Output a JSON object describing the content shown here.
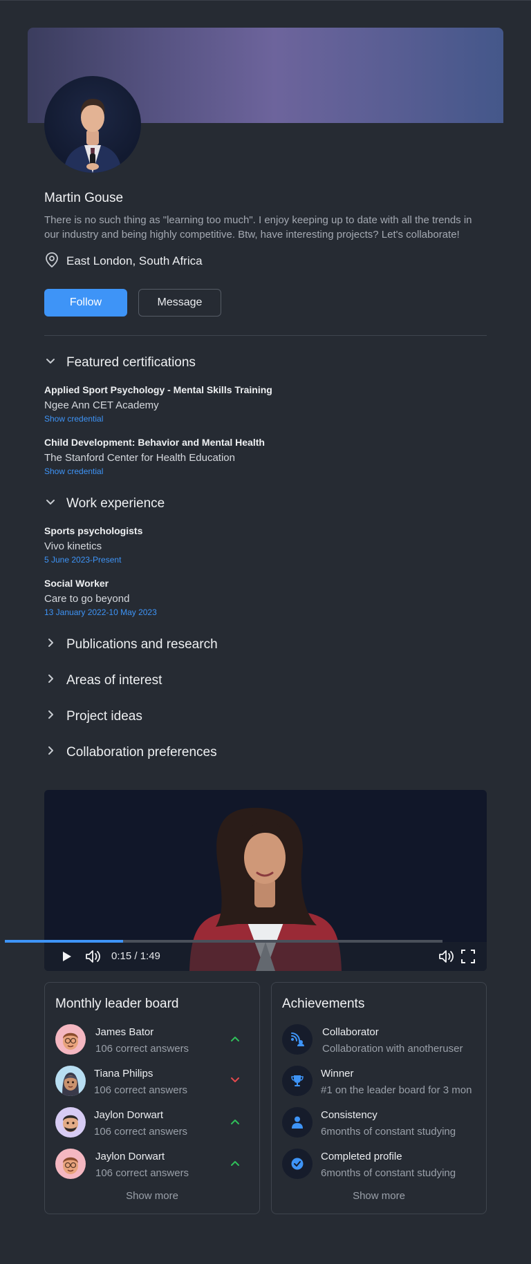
{
  "profile": {
    "name": "Martin Gouse",
    "bio": "There is no such thing as \"learning too much\". I enjoy keeping up to date with all the trends in our industry and being highly competitive. Btw, have interesting projects? Let's collaborate!",
    "location": "East London, South Africa",
    "follow_label": "Follow",
    "message_label": "Message"
  },
  "sections": {
    "certifications": {
      "title": "Featured certifications",
      "items": [
        {
          "title": "Applied Sport Psychology - Mental Skills Training",
          "org": "Ngee Ann CET Academy",
          "link": "Show credential"
        },
        {
          "title": "Child Development: Behavior and Mental Health",
          "org": "The Stanford Center for Health Education",
          "link": "Show credential"
        }
      ]
    },
    "work": {
      "title": "Work experience",
      "items": [
        {
          "title": "Sports psychologists",
          "org": "Vivo kinetics",
          "dates": "5 June 2023-Present"
        },
        {
          "title": "Social Worker",
          "org": "Care to go beyond",
          "dates": "13 January 2022-10 May 2023"
        }
      ]
    },
    "collapsed": [
      "Publications and research",
      "Areas of interest",
      "Project ideas",
      "Collaboration preferences"
    ]
  },
  "video": {
    "time": "0:15 / 1:49",
    "progress_fraction": 0.27
  },
  "leaderboard": {
    "title": "Monthly leader board",
    "rows": [
      {
        "name": "James Bator",
        "score": "106 correct answers",
        "trend": "up"
      },
      {
        "name": "Tiana Philips",
        "score": "106 correct answers",
        "trend": "down"
      },
      {
        "name": "Jaylon Dorwart",
        "score": "106 correct answers",
        "trend": "up"
      },
      {
        "name": "Jaylon Dorwart",
        "score": "106 correct answers",
        "trend": "up"
      }
    ],
    "show_more": "Show more"
  },
  "achievements": {
    "title": "Achievements",
    "rows": [
      {
        "name": "Collaborator",
        "desc": "Collaboration with anotheruser",
        "icon": "collaborator-icon"
      },
      {
        "name": "Winner",
        "desc": "#1 on the leader board for 3 mon",
        "icon": "trophy-icon"
      },
      {
        "name": "Consistency",
        "desc": "6months of constant studying",
        "icon": "person-icon"
      },
      {
        "name": "Completed profile",
        "desc": "6months of constant studying",
        "icon": "check-badge-icon"
      }
    ],
    "show_more": "Show more"
  },
  "colors": {
    "accent": "#3e94f7",
    "up": "#2fbf5a",
    "down": "#e5484d",
    "background": "#262b33"
  }
}
